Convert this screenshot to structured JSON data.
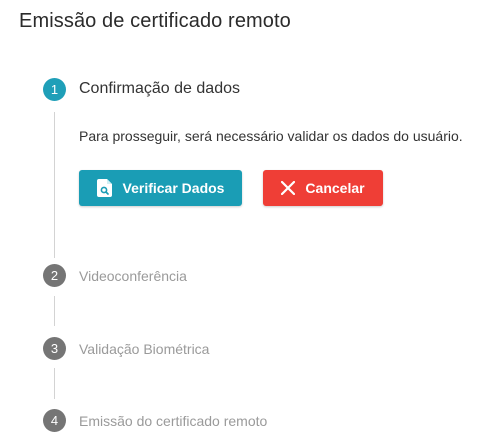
{
  "page": {
    "title": "Emissão de certificado remoto"
  },
  "steps": [
    {
      "number": "1",
      "label": "Confirmação de dados",
      "state": "active"
    },
    {
      "number": "2",
      "label": "Videoconferência",
      "state": "inactive"
    },
    {
      "number": "3",
      "label": "Validação Biométrica",
      "state": "inactive"
    },
    {
      "number": "4",
      "label": "Emissão do certificado remoto",
      "state": "inactive"
    }
  ],
  "step1": {
    "description": "Para prosseguir, será necessário validar os dados do usuário.",
    "verify_label": "Verificar Dados",
    "verify_icon": "document-search-icon",
    "cancel_label": "Cancelar",
    "cancel_icon": "close-icon"
  },
  "colors": {
    "accent": "#1a9db5",
    "danger": "#ef3e36",
    "inactive_step": "#757575"
  }
}
